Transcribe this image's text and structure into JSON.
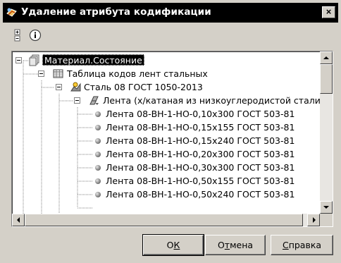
{
  "window": {
    "title": "Удаление атрибута кодификации",
    "close_glyph": "×"
  },
  "toolbar": {
    "buttons": [
      {
        "icon": "tree-expand-icon"
      },
      {
        "icon": "info-icon"
      }
    ]
  },
  "tree": {
    "root": {
      "label": "Материал.Состояние",
      "icon": "documents-icon",
      "selected": true
    },
    "table": {
      "label": "Таблица кодов лент стальных",
      "icon": "table-icon"
    },
    "steel": {
      "label": "Сталь 08 ГОСТ 1050-2013",
      "icon": "steel-icon"
    },
    "tape": {
      "label": "Лента (х/катаная из низкоуглеродистой стали)",
      "icon": "tape-icon"
    },
    "items": [
      "Лента 08-ВН-1-НО-0,10х300 ГОСТ 503-81",
      "Лента 08-ВН-1-НО-0,15х155 ГОСТ 503-81",
      "Лента 08-ВН-1-НО-0,15х240 ГОСТ 503-81",
      "Лента 08-ВН-1-НО-0,20х300 ГОСТ 503-81",
      "Лента 08-ВН-1-НО-0,30х300 ГОСТ 503-81",
      "Лента 08-ВН-1-НО-0,50х155 ГОСТ 503-81",
      "Лента 08-ВН-1-НО-0,50х240 ГОСТ 503-81"
    ]
  },
  "buttons": {
    "ok": {
      "pre": "О",
      "u": "К",
      "post": ""
    },
    "cancel": {
      "pre": "О",
      "u": "т",
      "post": "мена"
    },
    "help": {
      "pre": "",
      "u": "С",
      "post": "правка"
    }
  }
}
